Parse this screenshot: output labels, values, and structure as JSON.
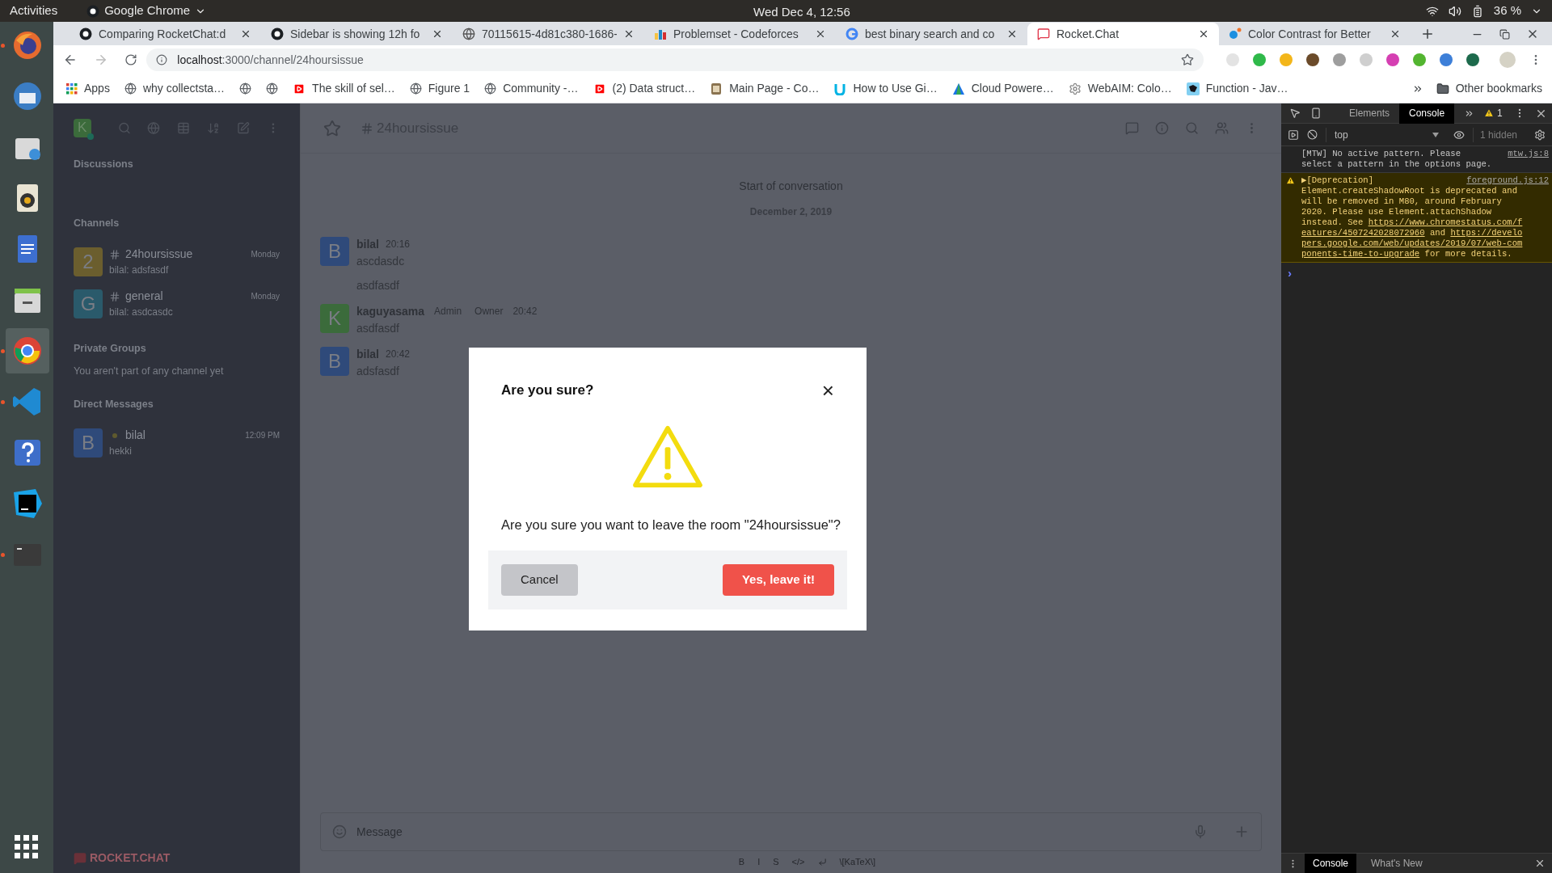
{
  "top_bar": {
    "activities": "Activities",
    "app": "Google Chrome",
    "clock": "Wed Dec  4, 12:56",
    "battery": "36 %"
  },
  "dock": [
    {
      "kind": "browser",
      "running": true,
      "selected": false
    },
    {
      "kind": "mail",
      "running": false,
      "selected": false
    },
    {
      "kind": "installer",
      "running": false,
      "selected": false
    },
    {
      "kind": "speaker",
      "running": false,
      "selected": false
    },
    {
      "kind": "document",
      "running": false,
      "selected": false
    },
    {
      "kind": "drawer",
      "running": false,
      "selected": false
    },
    {
      "kind": "chrome",
      "running": true,
      "selected": true
    },
    {
      "kind": "editor",
      "running": true,
      "selected": false
    },
    {
      "kind": "help",
      "running": false,
      "selected": false
    },
    {
      "kind": "ide",
      "running": false,
      "selected": false
    },
    {
      "kind": "terminal",
      "running": true,
      "selected": false
    }
  ],
  "tabs": [
    {
      "label": "Comparing RocketChat:d",
      "selected": false
    },
    {
      "label": "Sidebar is showing 12h fo",
      "selected": false
    },
    {
      "label": "70115615-4d81c380-1686-",
      "selected": false
    },
    {
      "label": "Problemset - Codeforces",
      "selected": false
    },
    {
      "label": "best binary search and co",
      "selected": false
    },
    {
      "label": "Rocket.Chat",
      "selected": true
    },
    {
      "label": "Color Contrast for Better",
      "selected": false
    }
  ],
  "address": {
    "host": "localhost",
    "path": ":3000/channel/24hoursissue"
  },
  "bookmarks": [
    {
      "kind": "apps",
      "label": "Apps"
    },
    {
      "kind": "globe",
      "label": "why collectsta…"
    },
    {
      "kind": "globe_only"
    },
    {
      "kind": "globe_only"
    },
    {
      "kind": "video",
      "label": "The skill of sel…"
    },
    {
      "kind": "globe",
      "label": "Figure 1"
    },
    {
      "kind": "globe",
      "label": "Community -…"
    },
    {
      "kind": "video",
      "label": "(2) Data struct…"
    },
    {
      "kind": "face",
      "label": "Main Page - Co…"
    },
    {
      "kind": "u",
      "label": "How to Use Gi…"
    },
    {
      "kind": "triangle",
      "label": "Cloud Powere…"
    },
    {
      "kind": "gear",
      "label": "WebAIM: Colo…"
    },
    {
      "kind": "square",
      "label": "Function - Jav…"
    }
  ],
  "other_bookmarks": "Other bookmarks",
  "sidebar": {
    "user_avatar": "K",
    "sections": [
      {
        "title": "Discussions"
      },
      {
        "title": "Channels",
        "items": [
          {
            "avatar": "2",
            "color": "#6b5e2e",
            "name": "24hoursissue",
            "kind": "channel",
            "time": "Monday",
            "preview": "bilal: adsfasdf"
          },
          {
            "avatar": "G",
            "color": "#2a5a6b",
            "name": "general",
            "kind": "channel",
            "time": "Monday",
            "preview": "bilal: asdcasdc"
          }
        ]
      },
      {
        "title": "Private Groups",
        "empty": "You aren't part of any channel yet"
      },
      {
        "title": "Direct Messages",
        "items": [
          {
            "avatar": "B",
            "color": "#2f4a7a",
            "name": "bilal",
            "kind": "direct",
            "time": "12:09 PM",
            "preview": "hekki"
          }
        ]
      }
    ],
    "logo": "ROCKET.CHAT"
  },
  "room": {
    "name": "24hoursissue",
    "start": "Start of conversation",
    "date": "December 2, 2019",
    "messages": [
      {
        "avatar": "B",
        "color": "#2f4a7a",
        "user": "bilal",
        "time": "20:16",
        "lines": [
          "ascdasdc",
          "asdfasdf"
        ]
      },
      {
        "avatar": "K",
        "color": "#3b6b3b",
        "user": "kaguyasama",
        "roles": [
          "Admin",
          "Owner"
        ],
        "time": "20:42",
        "lines": [
          "asdfasdf"
        ]
      },
      {
        "avatar": "B",
        "color": "#2f4a7a",
        "user": "bilal",
        "time": "20:42",
        "lines": [
          "adsfasdf"
        ]
      }
    ],
    "composer": {
      "placeholder": "Message"
    },
    "format": [
      "B",
      "I",
      "S",
      "</>"
    ],
    "katex": "\\[KaTeX\\]"
  },
  "modal": {
    "title": "Are you sure?",
    "close": "×",
    "message": "Are you sure you want to leave the room \"24hoursissue\"?",
    "cancel": "Cancel",
    "confirm": "Yes, leave it!"
  },
  "devtools": {
    "tabs": [
      {
        "label": "Elements",
        "selected": false
      },
      {
        "label": "Console",
        "selected": true
      }
    ],
    "warnings": "1",
    "context": "top",
    "hidden": "1 hidden",
    "messages": [
      {
        "kind": "info",
        "source": "mtw.js:8",
        "lines": [
          [
            {
              "text": "[MTW] No active pattern. Please"
            }
          ],
          [
            {
              "text": "select a pattern in the options page."
            }
          ]
        ]
      },
      {
        "kind": "warning",
        "source": "foreground.js:12",
        "lines": [
          [
            {
              "text": "▶[Deprecation]"
            }
          ],
          [
            {
              "text": "Element.createShadowRoot is deprecated and"
            }
          ],
          [
            {
              "text": "will be removed in M80, around February"
            }
          ],
          [
            {
              "text": "2020. Please use Element.attachShadow"
            }
          ],
          [
            {
              "text": "instead. See "
            },
            {
              "text": "https://www.chromestatus.com/f",
              "link": true
            }
          ],
          [
            {
              "text": "eatures/4507242028072960",
              "link": true
            },
            {
              "text": " and "
            },
            {
              "text": "https://develo",
              "link": true
            }
          ],
          [
            {
              "text": "pers.google.com/web/updates/2019/07/web-com",
              "link": true
            }
          ],
          [
            {
              "text": "ponents-time-to-upgrade",
              "link": true
            },
            {
              "text": " for more details."
            }
          ]
        ]
      }
    ],
    "prompt": "›",
    "drawer_tabs": [
      {
        "label": "Console",
        "selected": true
      },
      {
        "label": "What's New",
        "selected": false
      }
    ]
  }
}
